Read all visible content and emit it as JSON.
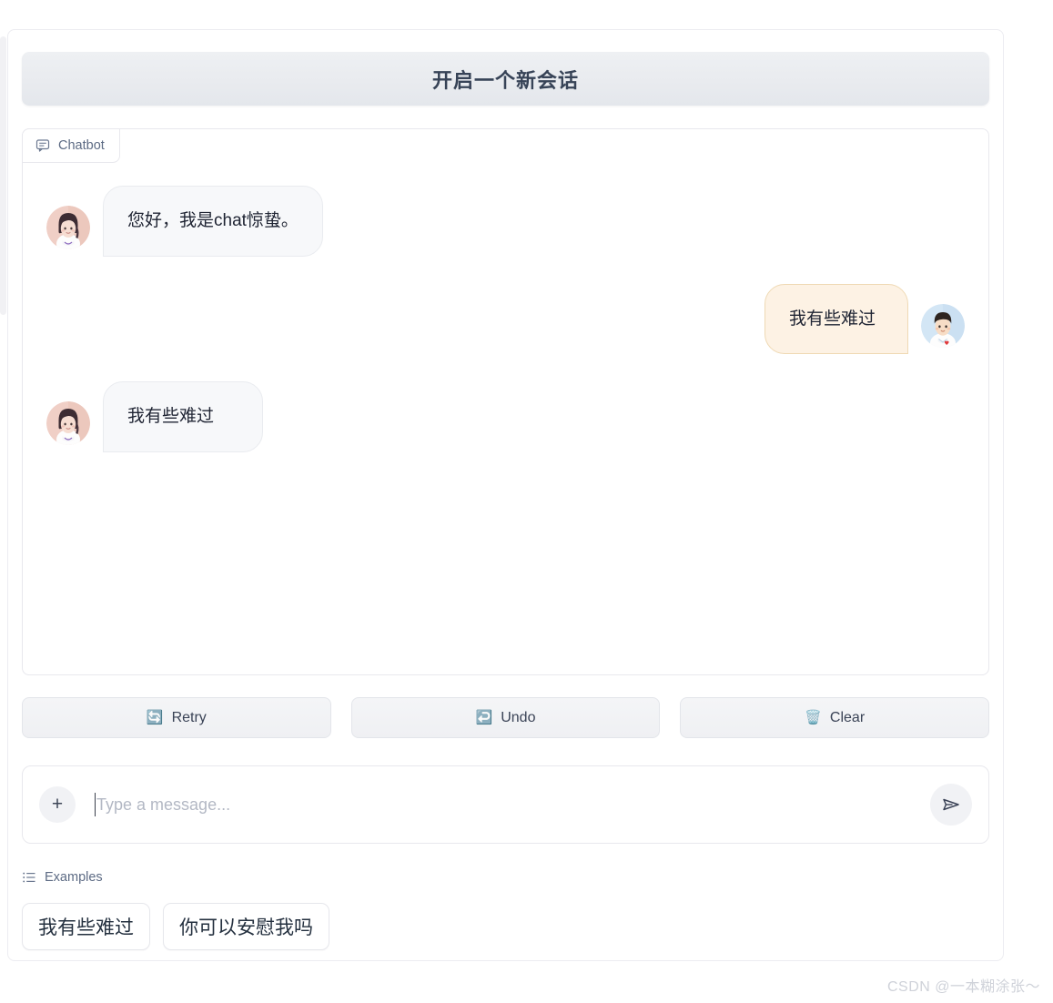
{
  "header": {
    "title": "开启一个新会话"
  },
  "chat_panel": {
    "label": "Chatbot",
    "label_icon": "speech-bubble-icon",
    "messages": [
      {
        "role": "bot",
        "text": "您好，我是chat惊蛰。",
        "avatar": "female-bot-avatar"
      },
      {
        "role": "user",
        "text": "我有些难过",
        "avatar": "male-user-avatar"
      },
      {
        "role": "bot",
        "text": "我有些难过",
        "avatar": "female-bot-avatar"
      }
    ]
  },
  "actions": [
    {
      "label": "Retry",
      "icon": "retry-icon",
      "emoji": "🔄"
    },
    {
      "label": "Undo",
      "icon": "undo-icon",
      "emoji": "↩️"
    },
    {
      "label": "Clear",
      "icon": "clear-icon",
      "emoji": "🗑️"
    }
  ],
  "input": {
    "plus_label": "+",
    "value": "",
    "placeholder": "Type a message...",
    "send_icon": "send-paper-plane-icon"
  },
  "examples": {
    "heading": "Examples",
    "heading_icon": "list-icon",
    "items": [
      "我有些难过",
      "你可以安慰我吗"
    ]
  },
  "watermark": "CSDN @一本糊涂张～",
  "colors": {
    "bot_bubble_bg": "#f7f8fa",
    "bot_bubble_border": "#e9ebef",
    "user_bubble_bg": "#fdf2e4",
    "user_bubble_border": "#efd9b4",
    "text_primary": "#1f2433",
    "label_text": "#5d6b84",
    "header_text": "#374357",
    "accent_blue": "#3b9bf0"
  }
}
